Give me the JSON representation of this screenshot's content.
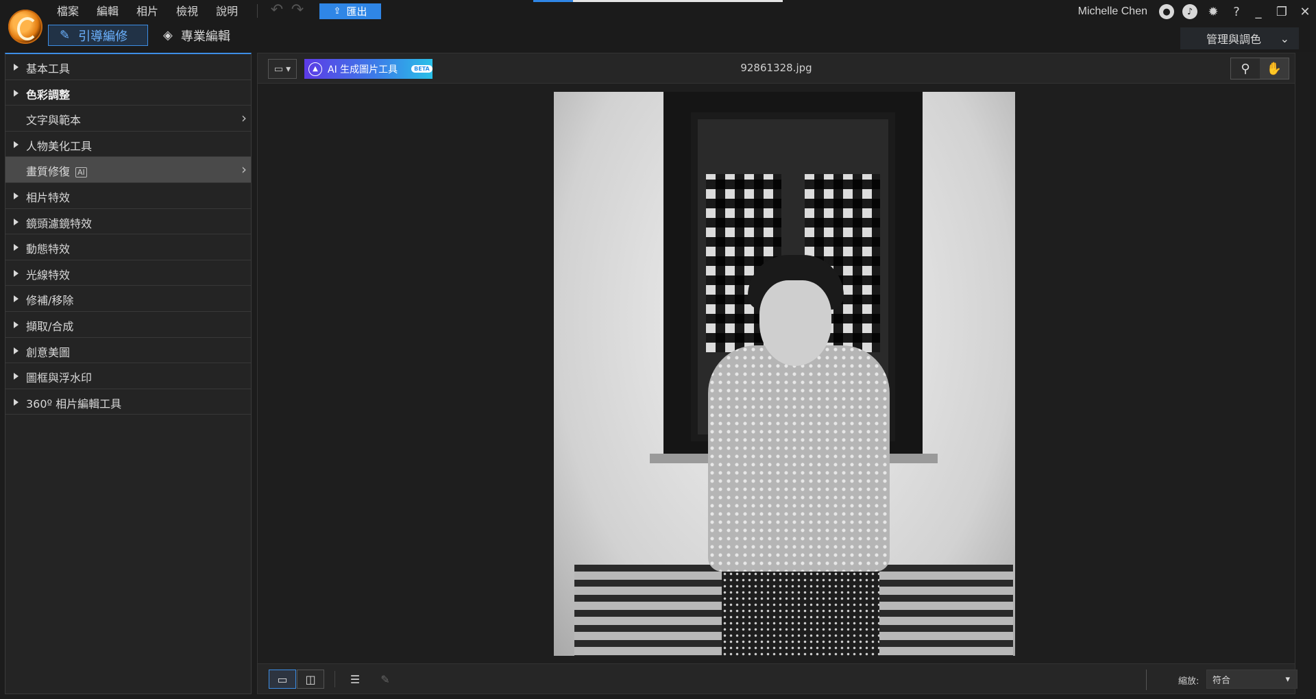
{
  "menu": {
    "items": [
      {
        "label": "檔案"
      },
      {
        "label": "編輯"
      },
      {
        "label": "相片"
      },
      {
        "label": "檢視"
      },
      {
        "label": "說明"
      }
    ]
  },
  "toolbar": {
    "export_label": "匯出",
    "progress_fraction": 0.16
  },
  "user": {
    "name": "Michelle Chen"
  },
  "modes": {
    "guided_label": "引導編修",
    "pro_label": "專業編輯",
    "manage_label": "管理與調色"
  },
  "sidebar": {
    "items": [
      {
        "label": "基本工具"
      },
      {
        "label": "色彩調整"
      },
      {
        "label": "文字與範本"
      },
      {
        "label": "人物美化工具"
      },
      {
        "label": "畫質修復",
        "badge": "AI"
      },
      {
        "label": "相片特效"
      },
      {
        "label": "鏡頭濾鏡特效"
      },
      {
        "label": "動態特效"
      },
      {
        "label": "光線特效"
      },
      {
        "label": "修補/移除"
      },
      {
        "label": "擷取/合成"
      },
      {
        "label": "創意美圖"
      },
      {
        "label": "圖框與浮水印"
      },
      {
        "label": "360º 相片編輯工具"
      }
    ]
  },
  "canvas": {
    "ai_gen_label": "AI 生成圖片工具",
    "beta_label": "BETA",
    "filename": "92861328.jpg",
    "zoom_label": "縮放:",
    "zoom_value": "符合"
  },
  "colors": {
    "accent": "#2f86e6",
    "background": "#1c1c1c",
    "selected_row": "#4a4a4a"
  },
  "icons": {
    "logo": "photodirector-logo",
    "undo": "undo-icon",
    "redo": "redo-icon",
    "export": "upload-icon",
    "account": "account-icon",
    "notification": "bell-icon",
    "settings": "gear-icon",
    "help": "question-icon",
    "zoom_tool": "magnifier-icon",
    "pan_tool": "hand-icon"
  }
}
